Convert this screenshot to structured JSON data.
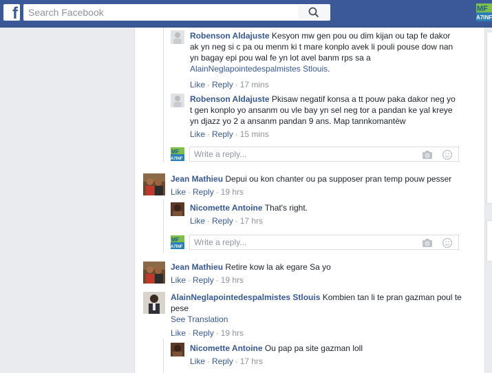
{
  "header": {
    "search_placeholder": "Search Facebook",
    "logo_letter": "f",
    "brand_color": "#3b5998",
    "avatar_text": "MF\nA7INF"
  },
  "comments": [
    {
      "author": "Robenson Aldajuste",
      "text": "Kesyon mw gen pou ou dim kijan ou tap fe dakor ak yn neg si c pa ou menm ki t mare konplo avek li pouli pouse dow nan yn bagay epi pou wal fe yn lot avel banm rps sa a",
      "mention": "AlainNeglapointedespalmistes Stlouis",
      "mention_suffix": ".",
      "like": "Like",
      "reply": "Reply",
      "time": "17 mins"
    },
    {
      "author": "Robenson Aldajuste",
      "text": "Pkisaw negatif konsa a tt pouw paka dakor neg yo t gen konplo yo ansanm ou vle bay yn sel neg tor a pandan ke yal kreye yn djazz yo 2 a ansanm pandan 9 ans. Map tannkomantèw",
      "like": "Like",
      "reply": "Reply",
      "time": "15 mins"
    },
    {
      "author": "Jean Mathieu",
      "text": "Depui ou kon chanter ou pa supposer pran temp pouw pesser",
      "like": "Like",
      "reply": "Reply",
      "time": "19 hrs"
    },
    {
      "author": "Nicomette Antoine",
      "text": "That's right.",
      "like": "Like",
      "reply": "Reply",
      "time": "17 hrs"
    },
    {
      "author": "Jean Mathieu",
      "text": "Retire kow la ak egare Sa yo",
      "like": "Like",
      "reply": "Reply",
      "time": "19 hrs"
    },
    {
      "author": "AlainNeglapointedespalmistes Stlouis",
      "text": "Kombien tan li te pran gazman poul te pese",
      "see_translation": "See Translation",
      "like": "Like",
      "reply": "Reply",
      "time": "19 hrs"
    },
    {
      "author": "Nicomette Antoine",
      "text": "Ou pap pa site gazman loll",
      "like": "Like",
      "reply": "Reply",
      "time": "17 hrs"
    }
  ],
  "reply_boxes": [
    {
      "placeholder": "Write a reply..."
    },
    {
      "placeholder": "Write a reply..."
    }
  ],
  "separator": "·"
}
